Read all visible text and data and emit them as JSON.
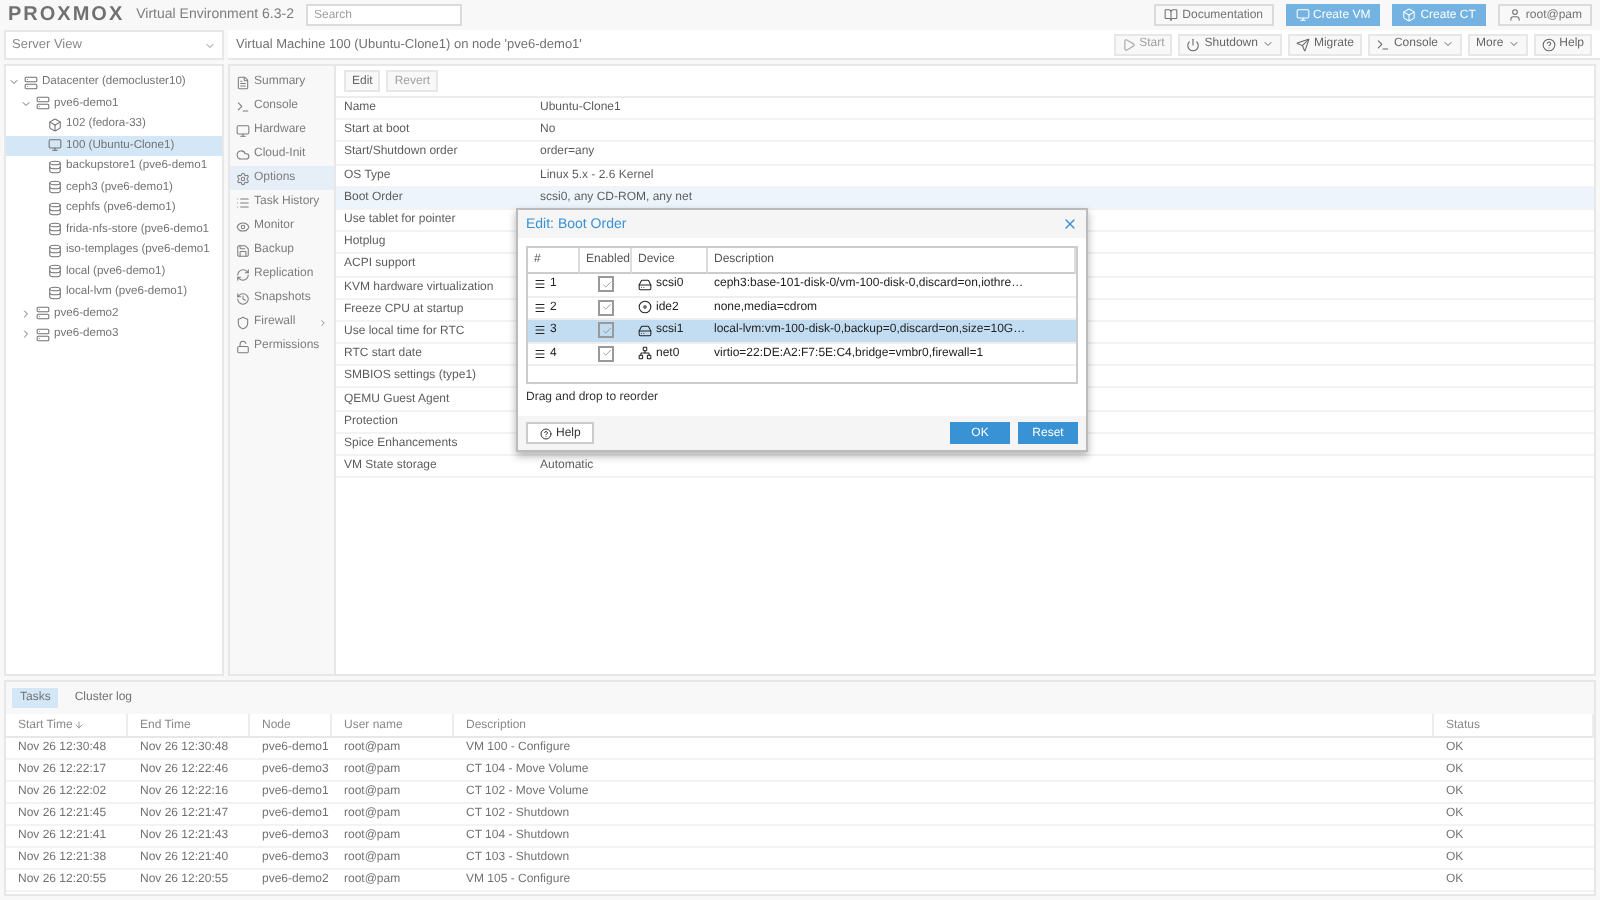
{
  "header": {
    "logo": "PROXMOX",
    "product": "Virtual Environment 6.3-2",
    "search": {
      "placeholder": "Search"
    },
    "buttons": [
      {
        "label": "Documentation",
        "kind": "doc",
        "primary": false
      },
      {
        "label": "Create VM",
        "kind": "vm",
        "primary": true
      },
      {
        "label": "Create CT",
        "kind": "ct",
        "primary": true
      },
      {
        "label": "root@pam",
        "kind": "user",
        "primary": false
      }
    ]
  },
  "view_select": {
    "value": "Server View"
  },
  "tree": [
    {
      "label": "Datacenter (democluster10)",
      "kind": "datacenter",
      "selected": false,
      "expanded": true,
      "children": [
        {
          "label": "pve6-demo1",
          "kind": "node",
          "selected": false,
          "expanded": true,
          "children": [
            {
              "label": "102 (fedora-33)",
              "kind": "ct",
              "selected": false
            },
            {
              "label": "100 (Ubuntu-Clone1)",
              "kind": "vm",
              "selected": true
            },
            {
              "label": "backupstore1 (pve6-demo1",
              "kind": "storage",
              "selected": false
            },
            {
              "label": "ceph3 (pve6-demo1)",
              "kind": "storage",
              "selected": false
            },
            {
              "label": "cephfs (pve6-demo1)",
              "kind": "storage",
              "selected": false
            },
            {
              "label": "frida-nfs-store (pve6-demo1",
              "kind": "storage",
              "selected": false
            },
            {
              "label": "iso-templages (pve6-demo1",
              "kind": "storage",
              "selected": false
            },
            {
              "label": "local (pve6-demo1)",
              "kind": "storage",
              "selected": false
            },
            {
              "label": "local-lvm (pve6-demo1)",
              "kind": "storage",
              "selected": false
            }
          ]
        },
        {
          "label": "pve6-demo2",
          "kind": "node",
          "selected": false,
          "expanded": false
        },
        {
          "label": "pve6-demo3",
          "kind": "node",
          "selected": false,
          "expanded": false
        }
      ]
    }
  ],
  "vm_title": "Virtual Machine 100 (Ubuntu-Clone1) on node 'pve6-demo1'",
  "vm_toolbar": [
    {
      "label": "Start",
      "kind": "start",
      "disabled": true,
      "menu": false
    },
    {
      "label": "Shutdown",
      "kind": "power",
      "disabled": false,
      "menu": true
    },
    {
      "label": "Migrate",
      "kind": "migrate",
      "disabled": false,
      "menu": false
    },
    {
      "label": "Console",
      "kind": "console",
      "disabled": false,
      "menu": true
    },
    {
      "label": "More",
      "kind": "none",
      "disabled": false,
      "menu": true
    },
    {
      "label": "Help",
      "kind": "help",
      "disabled": false,
      "menu": false
    }
  ],
  "nav": [
    {
      "label": "Summary",
      "kind": "summary",
      "selected": false
    },
    {
      "label": "Console",
      "kind": "console",
      "selected": false
    },
    {
      "label": "Hardware",
      "kind": "hardware",
      "selected": false
    },
    {
      "label": "Cloud-Init",
      "kind": "cloud",
      "selected": false
    },
    {
      "label": "Options",
      "kind": "options",
      "selected": true
    },
    {
      "label": "Task History",
      "kind": "tasks",
      "selected": false
    },
    {
      "label": "Monitor",
      "kind": "monitor",
      "selected": false
    },
    {
      "label": "Backup",
      "kind": "backup",
      "selected": false
    },
    {
      "label": "Replication",
      "kind": "replication",
      "selected": false
    },
    {
      "label": "Snapshots",
      "kind": "snapshots",
      "selected": false
    },
    {
      "label": "Firewall",
      "kind": "firewall",
      "selected": false,
      "submenu": true
    },
    {
      "label": "Permissions",
      "kind": "permissions",
      "selected": false
    }
  ],
  "options_toolbar": [
    {
      "label": "Edit",
      "disabled": false
    },
    {
      "label": "Revert",
      "disabled": true
    }
  ],
  "options": [
    {
      "name": "Name",
      "value": "Ubuntu-Clone1",
      "selected": false
    },
    {
      "name": "Start at boot",
      "value": "No",
      "selected": false
    },
    {
      "name": "Start/Shutdown order",
      "value": "order=any",
      "selected": false
    },
    {
      "name": "OS Type",
      "value": "Linux 5.x - 2.6 Kernel",
      "selected": false
    },
    {
      "name": "Boot Order",
      "value": "scsi0, any CD-ROM, any net",
      "selected": true
    },
    {
      "name": "Use tablet for pointer",
      "selected": false
    },
    {
      "name": "Hotplug",
      "selected": false
    },
    {
      "name": "ACPI support",
      "selected": false
    },
    {
      "name": "KVM hardware virtualization",
      "selected": false
    },
    {
      "name": "Freeze CPU at startup",
      "selected": false
    },
    {
      "name": "Use local time for RTC",
      "selected": false
    },
    {
      "name": "RTC start date",
      "selected": false
    },
    {
      "name": "SMBIOS settings (type1)",
      "selected": false
    },
    {
      "name": "QEMU Guest Agent",
      "selected": false
    },
    {
      "name": "Protection",
      "selected": false
    },
    {
      "name": "Spice Enhancements",
      "selected": false
    },
    {
      "name": "VM State storage",
      "value": "Automatic",
      "selected": false
    }
  ],
  "dialog": {
    "title": "Edit: Boot Order",
    "columns": [
      "#",
      "Enabled",
      "Device",
      "Description"
    ],
    "rows": [
      {
        "order": "1",
        "enabled": true,
        "kind": "disk",
        "device": "scsi0",
        "description": "ceph3:base-101-disk-0/vm-100-disk-0,discard=on,iothre…",
        "selected": false
      },
      {
        "order": "2",
        "enabled": true,
        "kind": "cdrom",
        "device": "ide2",
        "description": "none,media=cdrom",
        "selected": false
      },
      {
        "order": "3",
        "enabled": true,
        "kind": "disk",
        "device": "scsi1",
        "description": "local-lvm:vm-100-disk-0,backup=0,discard=on,size=10G…",
        "selected": true
      },
      {
        "order": "4",
        "enabled": true,
        "kind": "net",
        "device": "net0",
        "description": "virtio=22:DE:A2:F7:5E:C4,bridge=vmbr0,firewall=1",
        "selected": false
      }
    ],
    "hint": "Drag and drop to reorder",
    "help": "Help",
    "ok": "OK",
    "reset": "Reset"
  },
  "log_tabs": [
    {
      "label": "Tasks",
      "selected": true
    },
    {
      "label": "Cluster log",
      "selected": false
    }
  ],
  "tasks": {
    "columns": [
      "Start Time",
      "End Time",
      "Node",
      "User name",
      "Description",
      "Status"
    ],
    "rows": [
      [
        "Nov 26 12:30:48",
        "Nov 26 12:30:48",
        "pve6-demo1",
        "root@pam",
        "VM 100 - Configure",
        "OK"
      ],
      [
        "Nov 26 12:22:17",
        "Nov 26 12:22:46",
        "pve6-demo3",
        "root@pam",
        "CT 104 - Move Volume",
        "OK"
      ],
      [
        "Nov 26 12:22:02",
        "Nov 26 12:22:16",
        "pve6-demo1",
        "root@pam",
        "CT 102 - Move Volume",
        "OK"
      ],
      [
        "Nov 26 12:21:45",
        "Nov 26 12:21:47",
        "pve6-demo1",
        "root@pam",
        "CT 102 - Shutdown",
        "OK"
      ],
      [
        "Nov 26 12:21:41",
        "Nov 26 12:21:43",
        "pve6-demo3",
        "root@pam",
        "CT 104 - Shutdown",
        "OK"
      ],
      [
        "Nov 26 12:21:38",
        "Nov 26 12:21:40",
        "pve6-demo3",
        "root@pam",
        "CT 103 - Shutdown",
        "OK"
      ],
      [
        "Nov 26 12:20:55",
        "Nov 26 12:20:55",
        "pve6-demo2",
        "root@pam",
        "VM 105 - Configure",
        "OK"
      ]
    ]
  }
}
